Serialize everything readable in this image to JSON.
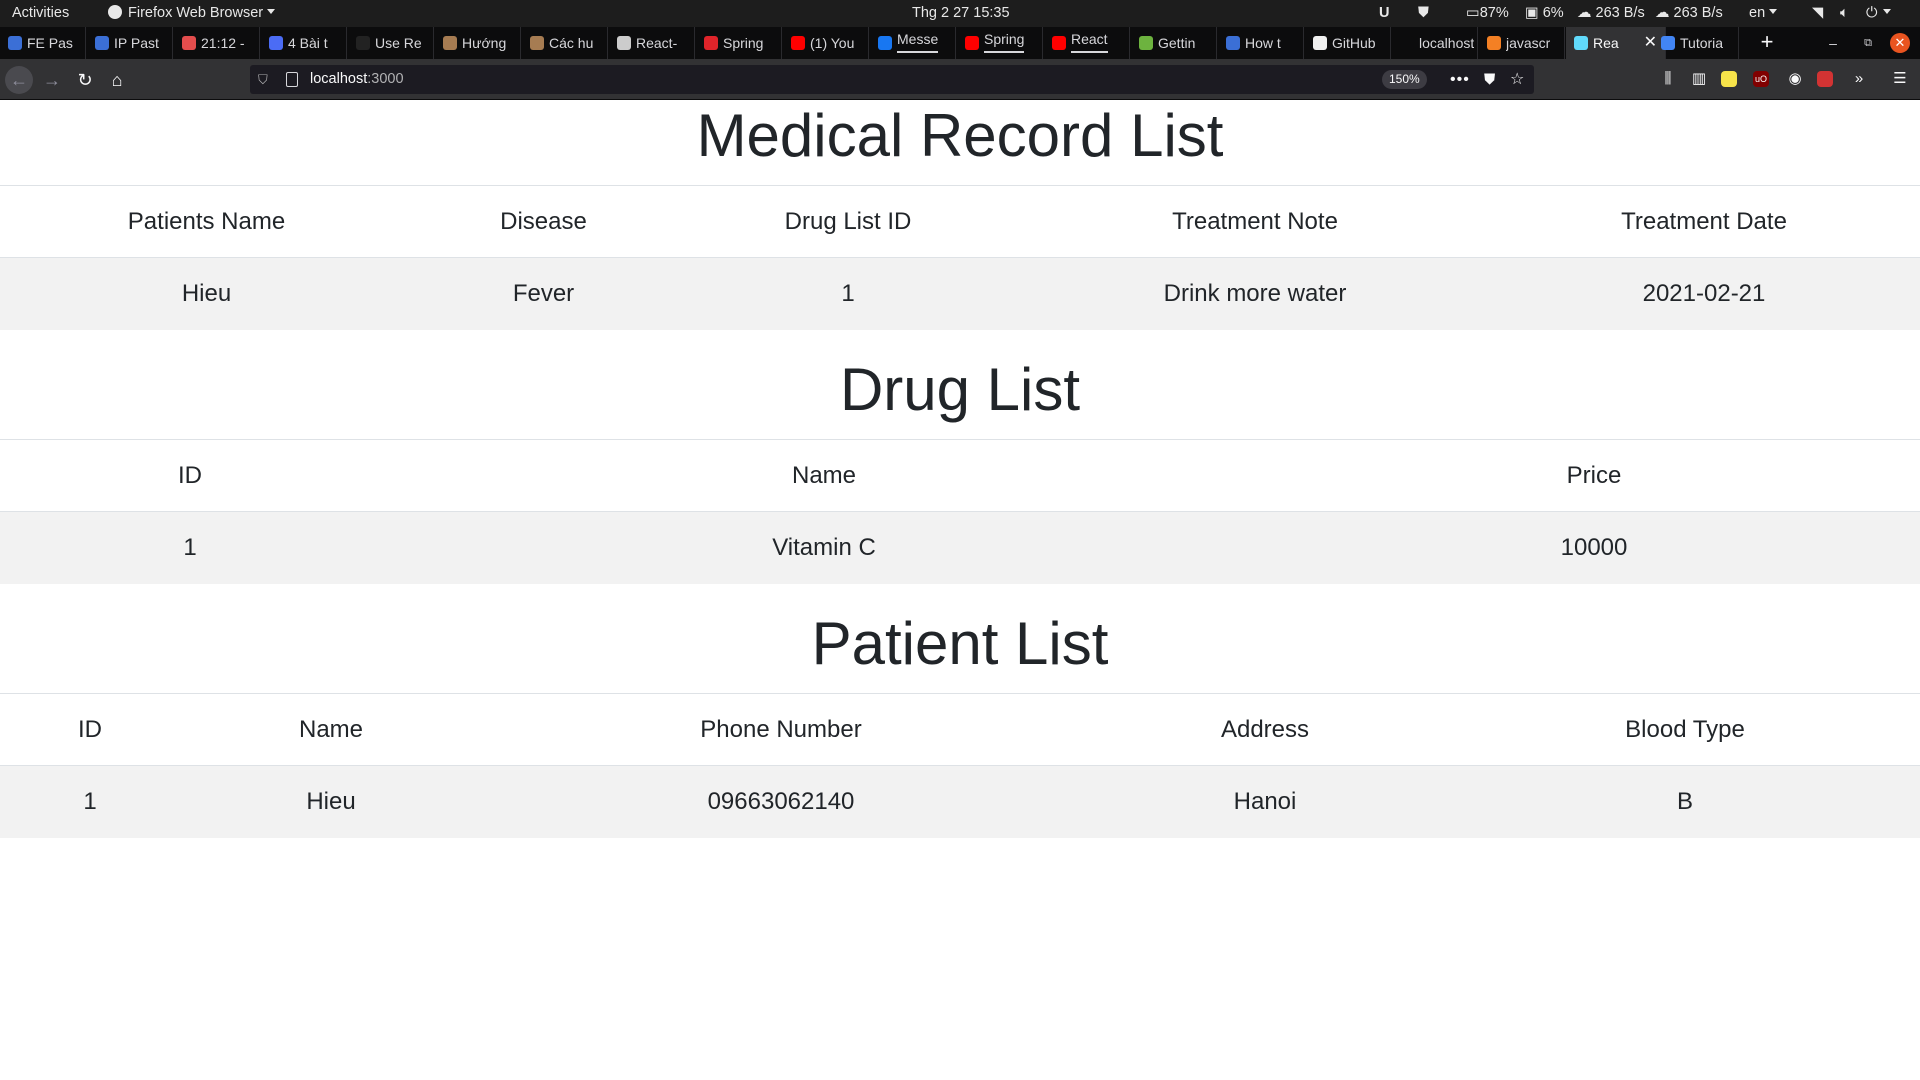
{
  "system_bar": {
    "activities": "Activities",
    "app_name": "Firefox Web Browser",
    "clock": "Thg 2 27  15:35",
    "battery": "87%",
    "disk": "6%",
    "upload": "263 B/s",
    "download": "263 B/s",
    "language": "en",
    "icons": [
      "u-icon",
      "shield-icon",
      "battery-icon",
      "disk-icon",
      "upload-cloud-icon",
      "download-cloud-icon",
      "wifi-icon",
      "volume-icon",
      "power-icon"
    ]
  },
  "browser": {
    "tabs": [
      {
        "label": "FE Pas",
        "favicon_color": "#3b6fd6"
      },
      {
        "label": "IP Past",
        "favicon_color": "#3b6fd6"
      },
      {
        "label": "21:12 -",
        "favicon_color": "#e34d4d"
      },
      {
        "label": "4 Bài t",
        "favicon_color": "#4b6cf5"
      },
      {
        "label": "Use Re",
        "favicon_color": "#222222"
      },
      {
        "label": "Hướng",
        "favicon_color": "#a67c52"
      },
      {
        "label": "Các hu",
        "favicon_color": "#a67c52"
      },
      {
        "label": "React-",
        "favicon_color": "#cccccc"
      },
      {
        "label": "Spring",
        "favicon_color": "#e0242a"
      },
      {
        "label": "(1) You",
        "favicon_color": "#ff0000"
      },
      {
        "label": "Messe",
        "favicon_color": "#1877f2"
      },
      {
        "label": "Spring",
        "favicon_color": "#ff0000"
      },
      {
        "label": "React",
        "favicon_color": "#ff0000"
      },
      {
        "label": "Gettin",
        "favicon_color": "#6db33f"
      },
      {
        "label": "How t",
        "favicon_color": "#3b6fd6"
      },
      {
        "label": "GitHub",
        "favicon_color": "#f0f0f0"
      },
      {
        "label": "localhost",
        "favicon_color": "#0c0c0d"
      },
      {
        "label": "javascr",
        "favicon_color": "#f48024"
      },
      {
        "label": "Rea",
        "favicon_color": "#61dafb"
      },
      {
        "label": "Tutoria",
        "favicon_color": "#4285f4"
      }
    ],
    "url_host": "localhost",
    "url_port": ":3000",
    "zoom": "150%"
  },
  "medical_records": {
    "title": "Medical Record List",
    "headers": [
      "Patients Name",
      "Disease",
      "Drug List ID",
      "Treatment Note",
      "Treatment Date"
    ],
    "rows": [
      [
        "Hieu",
        "Fever",
        "1",
        "Drink more water",
        "2021-02-21"
      ]
    ]
  },
  "drugs": {
    "title": "Drug List",
    "headers": [
      "ID",
      "Name",
      "Price"
    ],
    "rows": [
      [
        "1",
        "Vitamin C",
        "10000"
      ]
    ]
  },
  "patients": {
    "title": "Patient List",
    "headers": [
      "ID",
      "Name",
      "Phone Number",
      "Address",
      "Blood Type"
    ],
    "rows": [
      [
        "1",
        "Hieu",
        "09663062140",
        "Hanoi",
        "B"
      ]
    ]
  }
}
